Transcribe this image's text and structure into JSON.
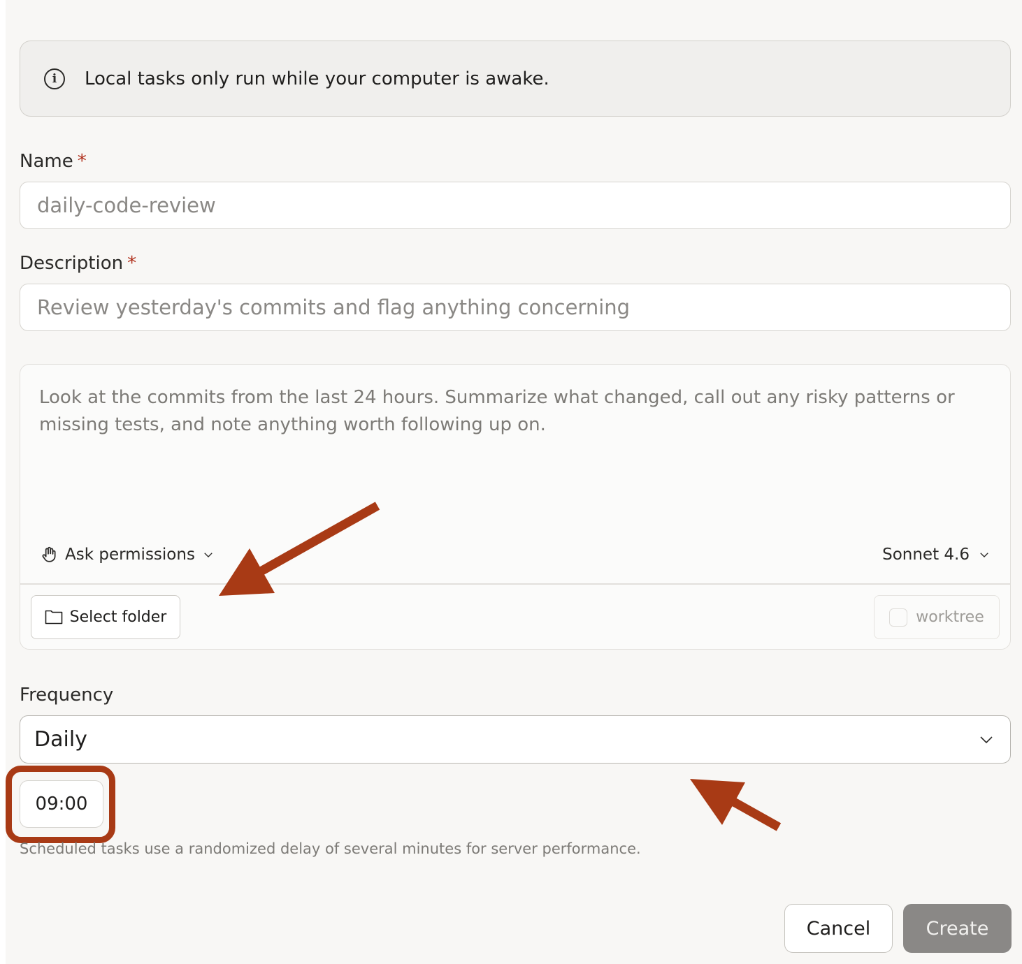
{
  "info_banner": {
    "icon": "info-icon",
    "text": "Local tasks only run while your computer is awake."
  },
  "name_field": {
    "label": "Name",
    "required_mark": "*",
    "placeholder": "daily-code-review"
  },
  "description_field": {
    "label": "Description",
    "required_mark": "*",
    "placeholder": "Review yesterday's commits and flag anything concerning"
  },
  "prompt": {
    "text": "Look at the commits from the last 24 hours. Summarize what changed, call out any risky patterns or missing tests, and note anything worth following up on.",
    "permissions_label": "Ask permissions",
    "model_label": "Sonnet 4.6",
    "select_folder_label": "Select folder",
    "worktree_label": "worktree"
  },
  "frequency": {
    "label": "Frequency",
    "value": "Daily",
    "time": "09:00"
  },
  "hint": "Scheduled tasks use a randomized delay of several minutes for server performance.",
  "actions": {
    "cancel_label": "Cancel",
    "create_label": "Create"
  },
  "colors": {
    "annotation": "#a83a15",
    "required": "#b0301c",
    "create_disabled": "#8a8886"
  }
}
